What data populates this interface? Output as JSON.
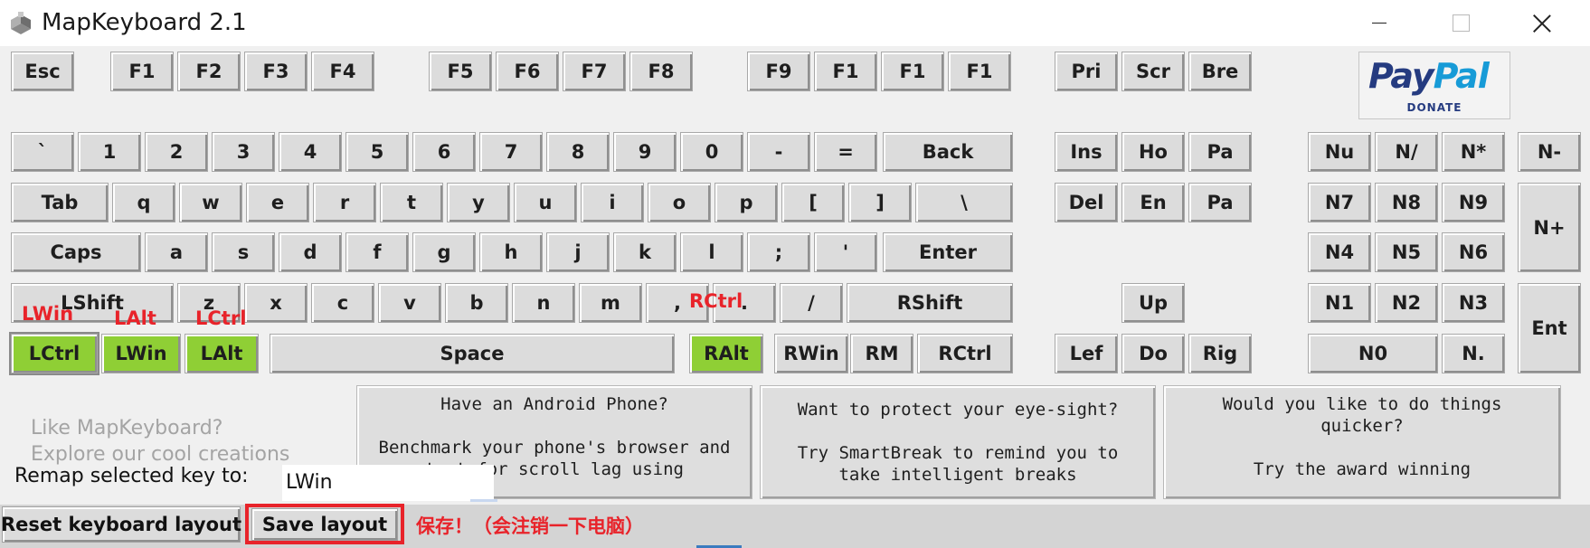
{
  "window": {
    "title": "MapKeyboard 2.1"
  },
  "function_row": [
    {
      "id": "esc",
      "label": "Esc"
    },
    {
      "id": "f1",
      "label": "F1"
    },
    {
      "id": "f2",
      "label": "F2"
    },
    {
      "id": "f3",
      "label": "F3"
    },
    {
      "id": "f4",
      "label": "F4"
    },
    {
      "id": "f5",
      "label": "F5"
    },
    {
      "id": "f6",
      "label": "F6"
    },
    {
      "id": "f7",
      "label": "F7"
    },
    {
      "id": "f8",
      "label": "F8"
    },
    {
      "id": "f9",
      "label": "F9"
    },
    {
      "id": "f10",
      "label": "F1"
    },
    {
      "id": "f11",
      "label": "F1"
    },
    {
      "id": "f12",
      "label": "F1"
    },
    {
      "id": "prtsc",
      "label": "Pri"
    },
    {
      "id": "scroll",
      "label": "Scr"
    },
    {
      "id": "break",
      "label": "Bre"
    }
  ],
  "number_row": [
    {
      "id": "backtick",
      "label": "`"
    },
    {
      "id": "1",
      "label": "1"
    },
    {
      "id": "2",
      "label": "2"
    },
    {
      "id": "3",
      "label": "3"
    },
    {
      "id": "4",
      "label": "4"
    },
    {
      "id": "5",
      "label": "5"
    },
    {
      "id": "6",
      "label": "6"
    },
    {
      "id": "7",
      "label": "7"
    },
    {
      "id": "8",
      "label": "8"
    },
    {
      "id": "9",
      "label": "9"
    },
    {
      "id": "0",
      "label": "0"
    },
    {
      "id": "minus",
      "label": "-"
    },
    {
      "id": "equals",
      "label": "="
    },
    {
      "id": "backspace",
      "label": "Back"
    }
  ],
  "tab_row": [
    {
      "id": "tab",
      "label": "Tab"
    },
    {
      "id": "q",
      "label": "q"
    },
    {
      "id": "w",
      "label": "w"
    },
    {
      "id": "e",
      "label": "e"
    },
    {
      "id": "r",
      "label": "r"
    },
    {
      "id": "t",
      "label": "t"
    },
    {
      "id": "y",
      "label": "y"
    },
    {
      "id": "u",
      "label": "u"
    },
    {
      "id": "i",
      "label": "i"
    },
    {
      "id": "o",
      "label": "o"
    },
    {
      "id": "p",
      "label": "p"
    },
    {
      "id": "lbracket",
      "label": "["
    },
    {
      "id": "rbracket",
      "label": "]"
    },
    {
      "id": "backslash",
      "label": "\\"
    }
  ],
  "caps_row": [
    {
      "id": "caps",
      "label": "Caps"
    },
    {
      "id": "a",
      "label": "a"
    },
    {
      "id": "s",
      "label": "s"
    },
    {
      "id": "d",
      "label": "d"
    },
    {
      "id": "f",
      "label": "f"
    },
    {
      "id": "g",
      "label": "g"
    },
    {
      "id": "h",
      "label": "h"
    },
    {
      "id": "j",
      "label": "j"
    },
    {
      "id": "k",
      "label": "k"
    },
    {
      "id": "l",
      "label": "l"
    },
    {
      "id": "semicolon",
      "label": ";"
    },
    {
      "id": "quote",
      "label": "'"
    },
    {
      "id": "enter",
      "label": "Enter"
    }
  ],
  "shift_row": [
    {
      "id": "lshift",
      "label": "LShift"
    },
    {
      "id": "z",
      "label": "z"
    },
    {
      "id": "x",
      "label": "x"
    },
    {
      "id": "c",
      "label": "c"
    },
    {
      "id": "v",
      "label": "v"
    },
    {
      "id": "b",
      "label": "b"
    },
    {
      "id": "n",
      "label": "n"
    },
    {
      "id": "m",
      "label": "m"
    },
    {
      "id": "comma",
      "label": ","
    },
    {
      "id": "period",
      "label": "."
    },
    {
      "id": "slash",
      "label": "/"
    },
    {
      "id": "rshift",
      "label": "RShift"
    }
  ],
  "ctrl_row": [
    {
      "id": "lctrl",
      "label": "LCtrl"
    },
    {
      "id": "lwin",
      "label": "LWin"
    },
    {
      "id": "lalt",
      "label": "LAlt"
    },
    {
      "id": "space",
      "label": "Space"
    },
    {
      "id": "ralt",
      "label": "RAlt"
    },
    {
      "id": "rwin",
      "label": "RWin"
    },
    {
      "id": "rmenu",
      "label": "RM"
    },
    {
      "id": "rctrl",
      "label": "RCtrl"
    }
  ],
  "mapped_keys": [
    "lctrl",
    "lwin",
    "lalt",
    "ralt"
  ],
  "selected_key": "lctrl",
  "nav_cluster": [
    {
      "id": "ins",
      "label": "Ins"
    },
    {
      "id": "home",
      "label": "Ho"
    },
    {
      "id": "pgup",
      "label": "Pa"
    },
    {
      "id": "del",
      "label": "Del"
    },
    {
      "id": "end",
      "label": "En"
    },
    {
      "id": "pgdn",
      "label": "Pa"
    },
    {
      "id": "up",
      "label": "Up"
    },
    {
      "id": "left",
      "label": "Lef"
    },
    {
      "id": "down",
      "label": "Do"
    },
    {
      "id": "right",
      "label": "Rig"
    }
  ],
  "numpad": [
    {
      "id": "numlock",
      "label": "Nu"
    },
    {
      "id": "ndiv",
      "label": "N/"
    },
    {
      "id": "nmul",
      "label": "N*"
    },
    {
      "id": "nminus",
      "label": "N-"
    },
    {
      "id": "n7",
      "label": "N7"
    },
    {
      "id": "n8",
      "label": "N8"
    },
    {
      "id": "n9",
      "label": "N9"
    },
    {
      "id": "nplus",
      "label": "N+"
    },
    {
      "id": "n4",
      "label": "N4"
    },
    {
      "id": "n5",
      "label": "N5"
    },
    {
      "id": "n6",
      "label": "N6"
    },
    {
      "id": "n1",
      "label": "N1"
    },
    {
      "id": "n2",
      "label": "N2"
    },
    {
      "id": "n3",
      "label": "N3"
    },
    {
      "id": "nenter",
      "label": "Ent"
    },
    {
      "id": "n0",
      "label": "N0"
    },
    {
      "id": "ndot",
      "label": "N."
    }
  ],
  "remap_overlays": [
    {
      "id": "lctrl",
      "text": "LWin"
    },
    {
      "id": "lwin",
      "text": "LAlt"
    },
    {
      "id": "lalt",
      "text": "LCtrl"
    },
    {
      "id": "ralt",
      "text": "RCtrl"
    }
  ],
  "paypal": {
    "brand_pay": "Pay",
    "brand_pal": "Pal",
    "donate": "DONATE"
  },
  "promos": [
    {
      "id": "android",
      "text": "Have an Android Phone?\n\nBenchmark your phone's browser and\ntest for scroll lag using"
    },
    {
      "id": "eyesight",
      "text": "Want to protect your eye-sight?\n\nTry SmartBreak to remind you to\ntake intelligent breaks"
    },
    {
      "id": "quicker",
      "text": "Would you like to do things\nquicker?\n\nTry the award winning"
    }
  ],
  "cross_promo": {
    "line1": "Like MapKeyboard?",
    "line2": "Explore our cool creations"
  },
  "remap": {
    "label": "Remap selected key to:",
    "value": "LWin"
  },
  "buttons": {
    "reset": "Reset keyboard layout",
    "save": "Save layout"
  },
  "annotation": {
    "save_note": "保存！（会注销一下电脑）"
  },
  "colors": {
    "mapped_key": "#8fcf35",
    "annotation_red": "#e8232a",
    "key_face": "#dcdcdc"
  }
}
